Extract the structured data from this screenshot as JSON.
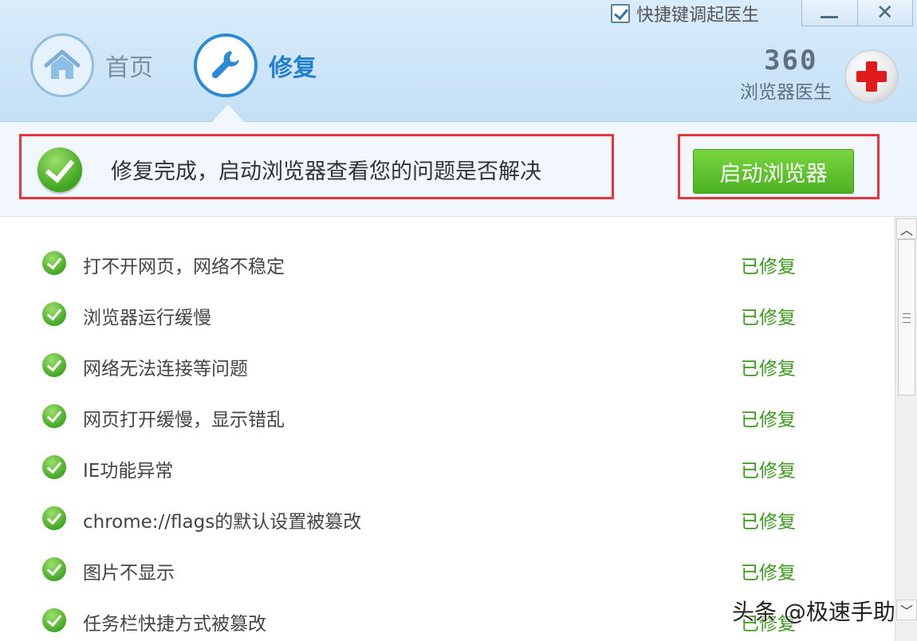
{
  "header": {
    "shortcut_checkbox": {
      "checked": true,
      "label": "快捷键调起医生"
    },
    "window_controls": {
      "minimize": "—",
      "close": "✕"
    },
    "tabs": [
      {
        "label": "首页",
        "icon": "home-icon",
        "active": false
      },
      {
        "label": "修复",
        "icon": "wrench-icon",
        "active": true
      }
    ],
    "brand": {
      "number": "360",
      "name": "浏览器医生",
      "logo_icon": "red-cross-icon"
    }
  },
  "status": {
    "icon": "check-circle-icon",
    "message": "修复完成，启动浏览器查看您的问题是否解决",
    "launch_button": "启动浏览器"
  },
  "list": {
    "items": [
      {
        "label": "打不开网页，网络不稳定",
        "status": "已修复"
      },
      {
        "label": "浏览器运行缓慢",
        "status": "已修复"
      },
      {
        "label": "网络无法连接等问题",
        "status": "已修复"
      },
      {
        "label": "网页打开缓慢，显示错乱",
        "status": "已修复"
      },
      {
        "label": "IE功能异常",
        "status": "已修复"
      },
      {
        "label": "chrome://flags的默认设置被篡改",
        "status": "已修复"
      },
      {
        "label": "图片不显示",
        "status": "已修复"
      },
      {
        "label": "任务栏快捷方式被篡改",
        "status": "已修复"
      }
    ]
  },
  "scrollbar": {
    "up": "︿",
    "down": "﹀"
  },
  "watermark": "头条 @极速手助",
  "colors": {
    "header_bg": "#c4e0f6",
    "accent_blue": "#2380d0",
    "success_green": "#3b9a1a",
    "highlight_red": "#e8353b",
    "button_green": "#4cb223"
  }
}
